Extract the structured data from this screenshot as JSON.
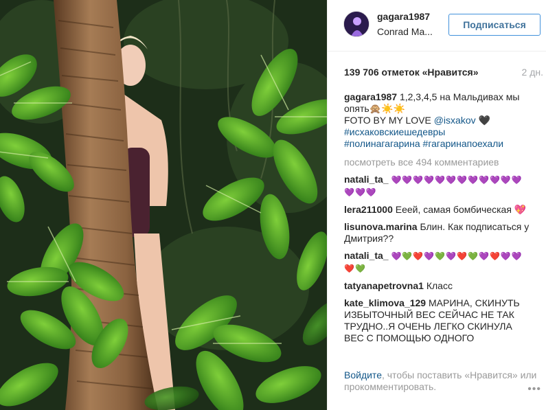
{
  "post": {
    "username": "gagara1987",
    "location": "Conrad Ma...",
    "follow_label": "Подписаться",
    "likes": "139 706 отметок «Нравится»",
    "time": "2 дн.",
    "caption": {
      "user": "gagara1987",
      "text1": "1,2,3,4,5 на Мальдивах мы опять🙊☀️☀️",
      "text2": "FOTO BY MY LOVE ",
      "mention": "@isxakov",
      "text3": " 🖤",
      "tag1": "#исхаковскиешедевры",
      "tag2": "#полинагагарина",
      "tag3": "#гагаринапоехали"
    },
    "view_all": "посмотреть все 494 комментариев"
  },
  "comments": [
    {
      "user": "natali_ta_",
      "text": "💜💜💜💜💜💜💜💜💜💜💜💜💜💜💜"
    },
    {
      "user": "lera211000",
      "text": "Ееей, самая бомбическая 💖"
    },
    {
      "user": "lisunova.marina",
      "text": "Блин. Как подписаться у Дмитрия??"
    },
    {
      "user": "natali_ta_",
      "text": "💜💚❤️💜💚💜❤️💚💜❤️💜💜❤️💚"
    },
    {
      "user": "tatyanapetrovna1",
      "text": "Класс"
    },
    {
      "user": "kate_klimova_129",
      "text": "МАРИНА, СКИНУТЬ ИЗБЫТОЧНЫЙ ВЕС СЕЙЧАС НЕ ТАК ТРУДНО..Я ОЧЕНЬ ЛЕГКО СКИНУЛА ВЕС С ПОМОЩЬЮ ОДНОГО СРЕДСТВА, ВСЕ ПОДРОБНОСТИ ТУТ"
    }
  ],
  "footer": {
    "login": "Войдите",
    "rest": ", чтобы поставить «Нравится» или прокомментировать.",
    "more": "•••"
  },
  "colors": {
    "link": "#125688",
    "follow_border": "#4090db",
    "follow_text": "#3f729b",
    "muted": "#999999"
  },
  "icons": {
    "more": "more-options-icon"
  }
}
